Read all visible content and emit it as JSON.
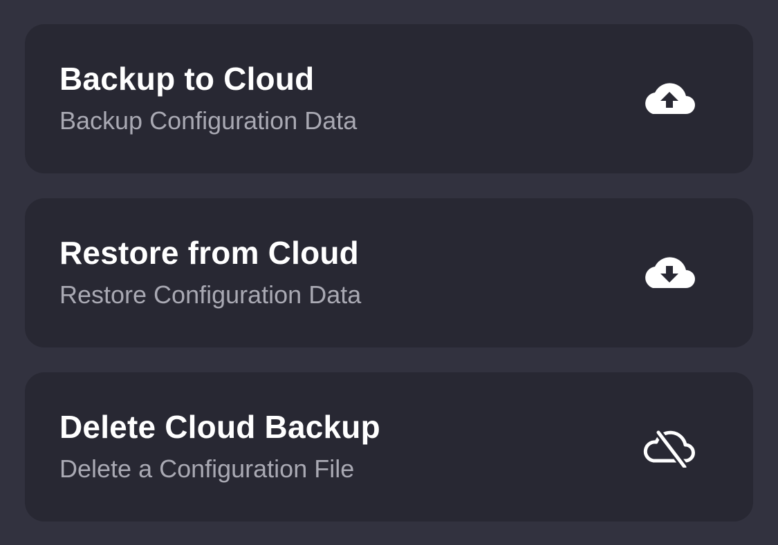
{
  "items": [
    {
      "title": "Backup to Cloud",
      "subtitle": "Backup Configuration Data",
      "icon": "cloud-upload-icon"
    },
    {
      "title": "Restore from Cloud",
      "subtitle": "Restore Configuration Data",
      "icon": "cloud-download-icon"
    },
    {
      "title": "Delete Cloud Backup",
      "subtitle": "Delete a Configuration File",
      "icon": "cloud-off-icon"
    }
  ],
  "colors": {
    "background": "#32323f",
    "card": "#282833",
    "title": "#ffffff",
    "subtitle": "#a9a9b3",
    "icon": "#ffffff"
  }
}
